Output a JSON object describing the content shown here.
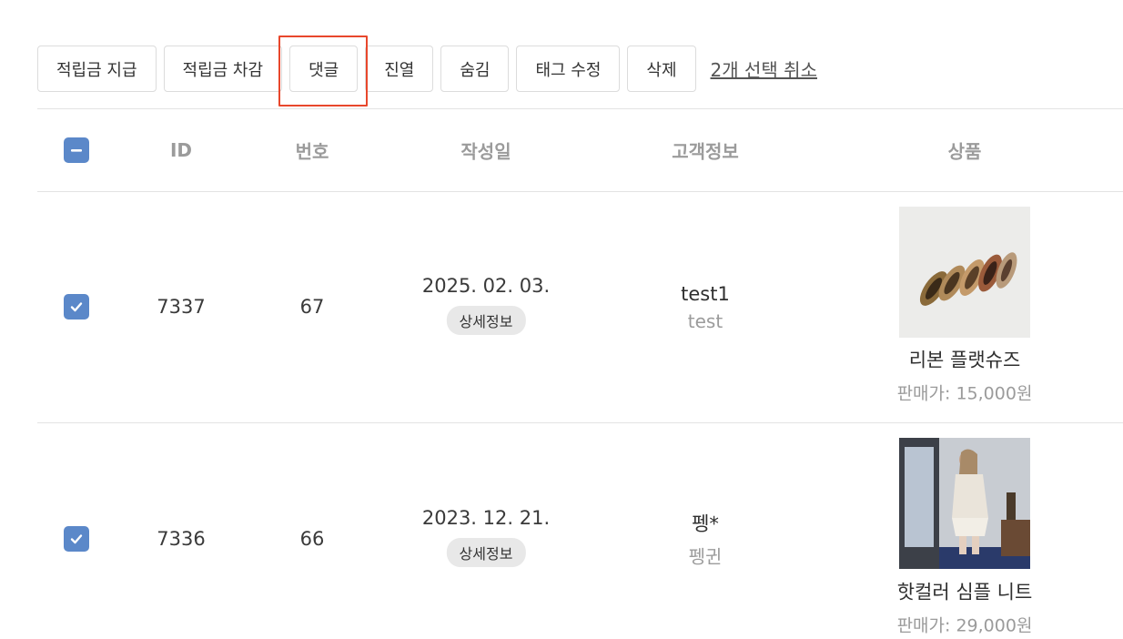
{
  "toolbar": {
    "buttons": [
      "적립금 지급",
      "적립금 차감",
      "댓글",
      "진열",
      "숨김",
      "태그 수정",
      "삭제"
    ],
    "cancel_selection": "2개 선택 취소"
  },
  "table": {
    "headers": {
      "id": "ID",
      "number": "번호",
      "date": "작성일",
      "customer": "고객정보",
      "product": "상품"
    },
    "rows": [
      {
        "id": "7337",
        "number": "67",
        "date": "2025. 02. 03.",
        "detail_label": "상세정보",
        "customer_name": "test1",
        "customer_id": "test",
        "product_name": "리본 플랫슈즈",
        "product_price": "판매가: 15,000원"
      },
      {
        "id": "7336",
        "number": "66",
        "date": "2023. 12. 21.",
        "detail_label": "상세정보",
        "customer_name": "펭*",
        "customer_id": "펭귄",
        "product_name": "핫컬러 심플 니트",
        "product_price": "판매가: 29,000원"
      }
    ]
  },
  "colors": {
    "checkbox": "#5b88c9",
    "highlight_border": "#e8472c"
  }
}
